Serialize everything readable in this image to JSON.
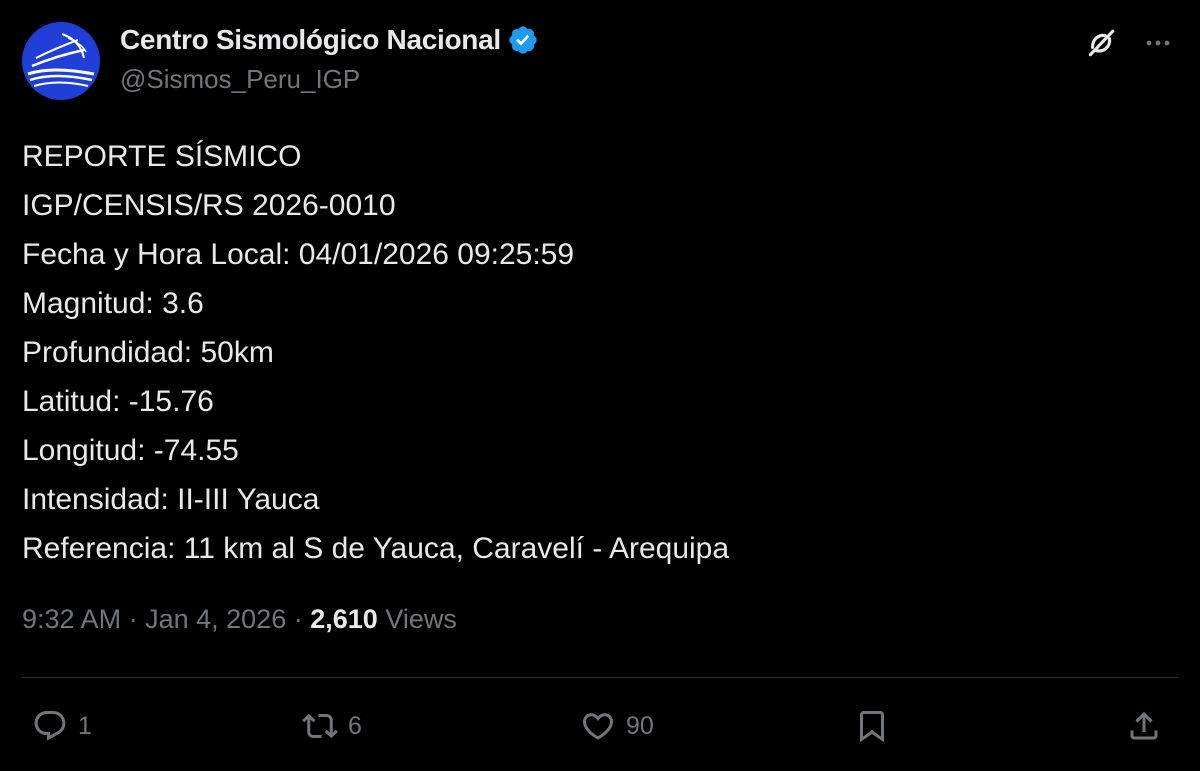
{
  "header": {
    "display_name": "Centro Sismológico Nacional",
    "handle": "@Sismos_Peru_IGP",
    "verified_icon": "verified-badge-icon",
    "grok_icon": "grok-icon",
    "more_icon": "more-options-icon"
  },
  "body": {
    "lines": [
      "REPORTE SÍSMICO",
      "IGP/CENSIS/RS 2026-0010",
      "Fecha y Hora Local: 04/01/2026 09:25:59",
      "Magnitud: 3.6",
      "Profundidad: 50km",
      "Latitud: -15.76",
      "Longitud: -74.55",
      "Intensidad: II-III Yauca",
      "Referencia: 11 km al S de Yauca, Caravelí - Arequipa"
    ]
  },
  "meta": {
    "time": "9:32 AM",
    "separator": "·",
    "date": "Jan 4, 2026",
    "views_count": "2,610",
    "views_label": "Views"
  },
  "actions": {
    "replies": "1",
    "reposts": "6",
    "likes": "90"
  },
  "colors": {
    "background": "#000000",
    "text": "#e7e9ea",
    "secondary": "#71767b",
    "verified": "#1d9bf0",
    "divider": "#2f3336"
  }
}
